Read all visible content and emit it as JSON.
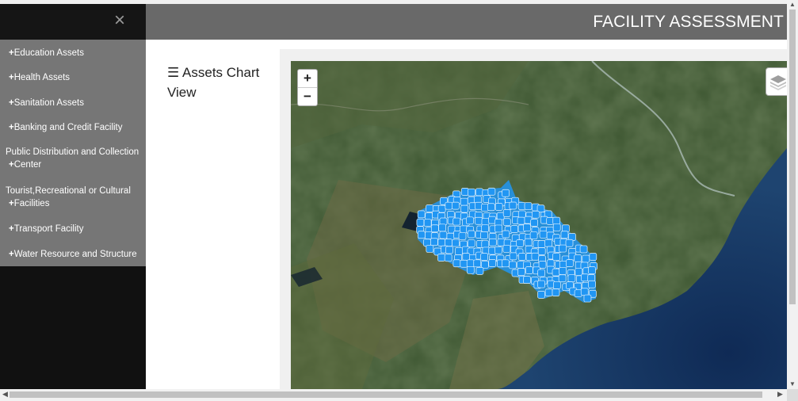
{
  "header": {
    "title": "FACILITY ASSESSMENT"
  },
  "sidebar": {
    "close_label": "×",
    "items": [
      {
        "plus": "+",
        "label": "Education Assets"
      },
      {
        "plus": "+",
        "label": "Health Assets"
      },
      {
        "plus": "+",
        "label": "Sanitation Assets"
      },
      {
        "plus": "+",
        "label": "Banking and Credit Facility"
      },
      {
        "line1": "Public Distribution and Collection",
        "plus": "+",
        "line2": "Center"
      },
      {
        "line1": "Tourist,Recreational or Cultural",
        "plus": "+",
        "line2": "Facilities"
      },
      {
        "plus": "+",
        "label": "Transport Facility"
      },
      {
        "plus": "+",
        "label": "Water Resource and Structure"
      }
    ]
  },
  "main": {
    "chart_title": "☰ Assets Chart View",
    "map": {
      "zoom_in": "+",
      "zoom_out": "−",
      "layers_icon": "layers-icon",
      "marker_color": "#2196f3"
    }
  },
  "scrollbars": {
    "up": "▲",
    "down": "▼",
    "left": "◀",
    "right": "▶"
  }
}
